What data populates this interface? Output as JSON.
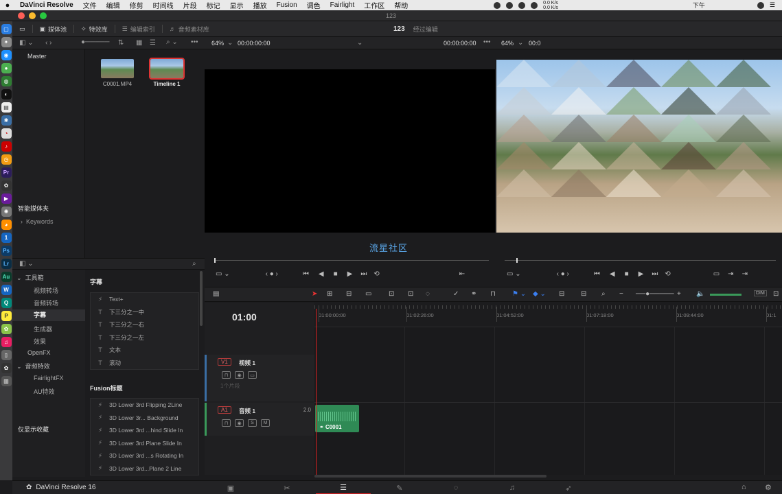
{
  "menubar": {
    "app": "DaVinci Resolve",
    "items": [
      "文件",
      "编辑",
      "修剪",
      "时间线",
      "片段",
      "标记",
      "显示",
      "播放",
      "Fusion",
      "调色",
      "Fairlight",
      "工作区",
      "帮助"
    ],
    "net_up": "0.0 K/s",
    "net_down": "0.0 K/s",
    "clock": "下午"
  },
  "window": {
    "title": "123"
  },
  "toolbar": {
    "media_pool": "媒体池",
    "effects_library": "特效库",
    "edit_index": "编辑索引",
    "sound_library": "音频素材库",
    "project_name": "123",
    "project_state": "经过编辑"
  },
  "subbar": {
    "source_zoom": "64%",
    "source_tc": "00:00:00:00",
    "program_tc": "00:00:00:00",
    "program_zoom": "64%",
    "program_tc2": "00:0"
  },
  "media_pool": {
    "master": "Master",
    "smart_bins": "智能媒体夹",
    "keywords": "Keywords",
    "clips": [
      {
        "name": "C0001.MP4",
        "selected": false
      },
      {
        "name": "Timeline 1",
        "selected": true
      }
    ]
  },
  "effects": {
    "tree": [
      {
        "label": "工具箱",
        "level": 0,
        "caret": "⌄"
      },
      {
        "label": "视频转场",
        "level": 1
      },
      {
        "label": "音频转场",
        "level": 1
      },
      {
        "label": "字幕",
        "level": 1,
        "active": true
      },
      {
        "label": "生成器",
        "level": 1
      },
      {
        "label": "效果",
        "level": 1
      },
      {
        "label": "OpenFX",
        "level": 0
      },
      {
        "label": "音频特效",
        "level": 0,
        "caret": "⌄"
      },
      {
        "label": "FairlightFX",
        "level": 1
      },
      {
        "label": "AU特效",
        "level": 1
      }
    ],
    "favorites": "仅显示收藏",
    "titles_group": "字幕",
    "titles": [
      {
        "icon": "⚡",
        "label": "Text+"
      },
      {
        "icon": "T",
        "label": "下三分之一中"
      },
      {
        "icon": "T",
        "label": "下三分之一右"
      },
      {
        "icon": "T",
        "label": "下三分之一左"
      },
      {
        "icon": "T",
        "label": "文本"
      },
      {
        "icon": "T",
        "label": "滚动"
      }
    ],
    "fusion_group": "Fusion标题",
    "fusion_titles": [
      {
        "icon": "⚡",
        "label": "3D Lower 3rd Flipping 2Line"
      },
      {
        "icon": "⚡",
        "label": "3D Lower 3r... Background"
      },
      {
        "icon": "⚡",
        "label": "3D Lower 3rd ...hind Slide In"
      },
      {
        "icon": "⚡",
        "label": "3D Lower 3rd Plane Slide In"
      },
      {
        "icon": "⚡",
        "label": "3D Lower 3rd ...s Rotating In"
      },
      {
        "icon": "⚡",
        "label": "3D Lower 3rd...Plane 2 Line"
      }
    ]
  },
  "viewer": {
    "watermark": "流星社区"
  },
  "timeline": {
    "timecode": "01:00",
    "ruler": [
      "01:00:00:00",
      "01:02:26:00",
      "01:04:52:00",
      "01:07:18:00",
      "01:09:44:00",
      "01:1"
    ],
    "video_track": {
      "tag": "V1",
      "name": "视频 1",
      "meta": "1个片段"
    },
    "audio_track": {
      "tag": "A1",
      "name": "音频 1",
      "channels": "2.0",
      "clip": "C0001"
    },
    "dim_label": "DIM"
  },
  "pagebar": {
    "brand": "DaVinci Resolve 16"
  },
  "colors": {
    "accent": "#d22222",
    "video_track": "#3a6ea5",
    "audio_clip": "#2f8a55",
    "watermark": "#5aa6e8"
  }
}
